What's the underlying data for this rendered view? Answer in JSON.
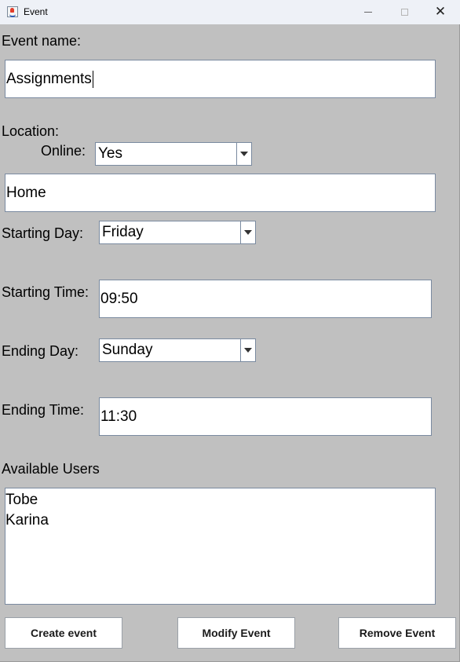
{
  "window": {
    "title": "Event",
    "icons": {
      "app": "java-app-icon",
      "minimize": "minimize-icon",
      "maximize": "maximize-icon",
      "close": "close-icon"
    },
    "close_glyph": "✕"
  },
  "form": {
    "event_name_label": "Event name:",
    "event_name_value": "Assignments",
    "location_label": "Location:",
    "online_label": "Online:",
    "online_value": "Yes",
    "location_value": "Home",
    "starting_day_label": "Starting Day:",
    "starting_day_value": "Friday",
    "starting_time_label": "Starting Time:",
    "starting_time_value": "09:50",
    "ending_day_label": "Ending Day:",
    "ending_day_value": "Sunday",
    "ending_time_label": "Ending Time:",
    "ending_time_value": "11:30",
    "available_users_label": "Available Users",
    "available_users": [
      "Tobe",
      "Karina"
    ]
  },
  "buttons": {
    "create": "Create event",
    "modify": "Modify Event",
    "remove": "Remove Event"
  },
  "colors": {
    "background": "#c0c0c0",
    "titlebar": "#eef1f7",
    "field_border": "#7a8aa0"
  }
}
